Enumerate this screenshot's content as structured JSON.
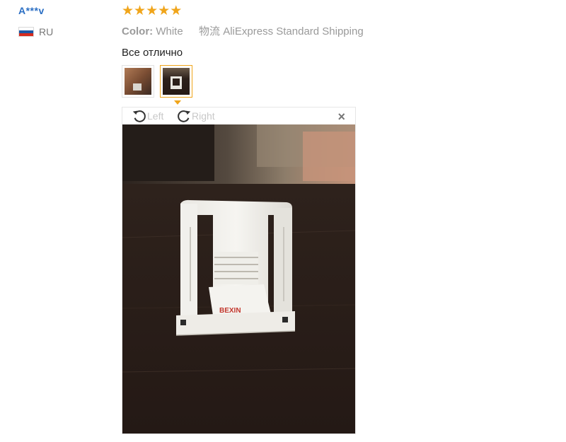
{
  "reviewer": {
    "name": "A***v",
    "country_code": "RU"
  },
  "review": {
    "rating": 5,
    "color_label": "Color:",
    "color_value": "White",
    "shipping_prefix": "物流",
    "shipping_value": "AliExpress Standard Shipping",
    "text": "Все отлично",
    "photo_count": 2,
    "selected_photo": 2
  },
  "viewer": {
    "rotate_left_label": "Left",
    "rotate_right_label": "Right",
    "close_glyph": "×",
    "photo_text": "BEXIN"
  },
  "colors": {
    "username": "#2b6fc4",
    "star": "#f0a51b",
    "active_thumb_border": "#f0a51b"
  },
  "icons": {
    "rating": "star-icon",
    "rotate_left": "rotate-left-icon",
    "rotate_right": "rotate-right-icon",
    "close": "close-icon",
    "flag": "russia-flag-icon"
  }
}
